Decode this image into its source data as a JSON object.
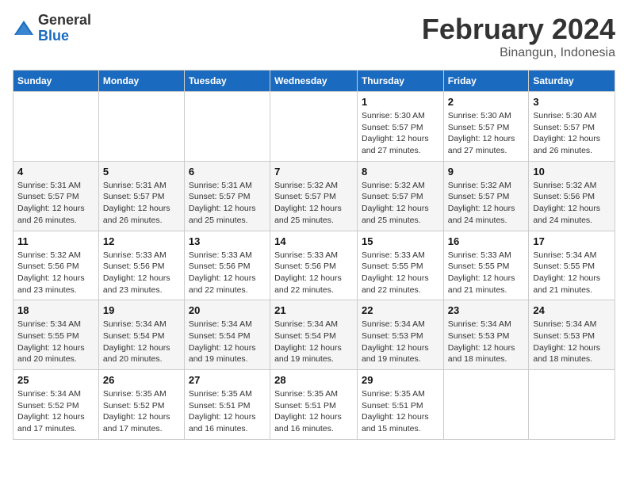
{
  "header": {
    "logo_general": "General",
    "logo_blue": "Blue",
    "month_title": "February 2024",
    "location": "Binangun, Indonesia"
  },
  "days_of_week": [
    "Sunday",
    "Monday",
    "Tuesday",
    "Wednesday",
    "Thursday",
    "Friday",
    "Saturday"
  ],
  "weeks": [
    [
      {
        "num": "",
        "info": ""
      },
      {
        "num": "",
        "info": ""
      },
      {
        "num": "",
        "info": ""
      },
      {
        "num": "",
        "info": ""
      },
      {
        "num": "1",
        "info": "Sunrise: 5:30 AM\nSunset: 5:57 PM\nDaylight: 12 hours\nand 27 minutes."
      },
      {
        "num": "2",
        "info": "Sunrise: 5:30 AM\nSunset: 5:57 PM\nDaylight: 12 hours\nand 27 minutes."
      },
      {
        "num": "3",
        "info": "Sunrise: 5:30 AM\nSunset: 5:57 PM\nDaylight: 12 hours\nand 26 minutes."
      }
    ],
    [
      {
        "num": "4",
        "info": "Sunrise: 5:31 AM\nSunset: 5:57 PM\nDaylight: 12 hours\nand 26 minutes."
      },
      {
        "num": "5",
        "info": "Sunrise: 5:31 AM\nSunset: 5:57 PM\nDaylight: 12 hours\nand 26 minutes."
      },
      {
        "num": "6",
        "info": "Sunrise: 5:31 AM\nSunset: 5:57 PM\nDaylight: 12 hours\nand 25 minutes."
      },
      {
        "num": "7",
        "info": "Sunrise: 5:32 AM\nSunset: 5:57 PM\nDaylight: 12 hours\nand 25 minutes."
      },
      {
        "num": "8",
        "info": "Sunrise: 5:32 AM\nSunset: 5:57 PM\nDaylight: 12 hours\nand 25 minutes."
      },
      {
        "num": "9",
        "info": "Sunrise: 5:32 AM\nSunset: 5:57 PM\nDaylight: 12 hours\nand 24 minutes."
      },
      {
        "num": "10",
        "info": "Sunrise: 5:32 AM\nSunset: 5:56 PM\nDaylight: 12 hours\nand 24 minutes."
      }
    ],
    [
      {
        "num": "11",
        "info": "Sunrise: 5:32 AM\nSunset: 5:56 PM\nDaylight: 12 hours\nand 23 minutes."
      },
      {
        "num": "12",
        "info": "Sunrise: 5:33 AM\nSunset: 5:56 PM\nDaylight: 12 hours\nand 23 minutes."
      },
      {
        "num": "13",
        "info": "Sunrise: 5:33 AM\nSunset: 5:56 PM\nDaylight: 12 hours\nand 22 minutes."
      },
      {
        "num": "14",
        "info": "Sunrise: 5:33 AM\nSunset: 5:56 PM\nDaylight: 12 hours\nand 22 minutes."
      },
      {
        "num": "15",
        "info": "Sunrise: 5:33 AM\nSunset: 5:55 PM\nDaylight: 12 hours\nand 22 minutes."
      },
      {
        "num": "16",
        "info": "Sunrise: 5:33 AM\nSunset: 5:55 PM\nDaylight: 12 hours\nand 21 minutes."
      },
      {
        "num": "17",
        "info": "Sunrise: 5:34 AM\nSunset: 5:55 PM\nDaylight: 12 hours\nand 21 minutes."
      }
    ],
    [
      {
        "num": "18",
        "info": "Sunrise: 5:34 AM\nSunset: 5:55 PM\nDaylight: 12 hours\nand 20 minutes."
      },
      {
        "num": "19",
        "info": "Sunrise: 5:34 AM\nSunset: 5:54 PM\nDaylight: 12 hours\nand 20 minutes."
      },
      {
        "num": "20",
        "info": "Sunrise: 5:34 AM\nSunset: 5:54 PM\nDaylight: 12 hours\nand 19 minutes."
      },
      {
        "num": "21",
        "info": "Sunrise: 5:34 AM\nSunset: 5:54 PM\nDaylight: 12 hours\nand 19 minutes."
      },
      {
        "num": "22",
        "info": "Sunrise: 5:34 AM\nSunset: 5:53 PM\nDaylight: 12 hours\nand 19 minutes."
      },
      {
        "num": "23",
        "info": "Sunrise: 5:34 AM\nSunset: 5:53 PM\nDaylight: 12 hours\nand 18 minutes."
      },
      {
        "num": "24",
        "info": "Sunrise: 5:34 AM\nSunset: 5:53 PM\nDaylight: 12 hours\nand 18 minutes."
      }
    ],
    [
      {
        "num": "25",
        "info": "Sunrise: 5:34 AM\nSunset: 5:52 PM\nDaylight: 12 hours\nand 17 minutes."
      },
      {
        "num": "26",
        "info": "Sunrise: 5:35 AM\nSunset: 5:52 PM\nDaylight: 12 hours\nand 17 minutes."
      },
      {
        "num": "27",
        "info": "Sunrise: 5:35 AM\nSunset: 5:51 PM\nDaylight: 12 hours\nand 16 minutes."
      },
      {
        "num": "28",
        "info": "Sunrise: 5:35 AM\nSunset: 5:51 PM\nDaylight: 12 hours\nand 16 minutes."
      },
      {
        "num": "29",
        "info": "Sunrise: 5:35 AM\nSunset: 5:51 PM\nDaylight: 12 hours\nand 15 minutes."
      },
      {
        "num": "",
        "info": ""
      },
      {
        "num": "",
        "info": ""
      }
    ]
  ]
}
